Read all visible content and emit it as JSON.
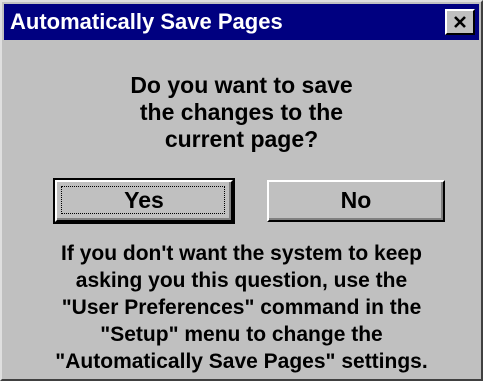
{
  "window": {
    "title": "Automatically Save Pages",
    "close_icon": "close-icon"
  },
  "message": {
    "question_lines": [
      "Do you want to save",
      "the changes to the",
      "current page?"
    ]
  },
  "buttons": {
    "yes_label": "Yes",
    "no_label": "No"
  },
  "info": {
    "lines": [
      "If you don't want the system to keep",
      "asking you this question, use the",
      "\"User Preferences\" command in the",
      "\"Setup\" menu to change the",
      "\"Automatically Save Pages\" settings."
    ]
  },
  "colors": {
    "titlebar": "#000080",
    "dialog_face": "#c0c0c0"
  }
}
